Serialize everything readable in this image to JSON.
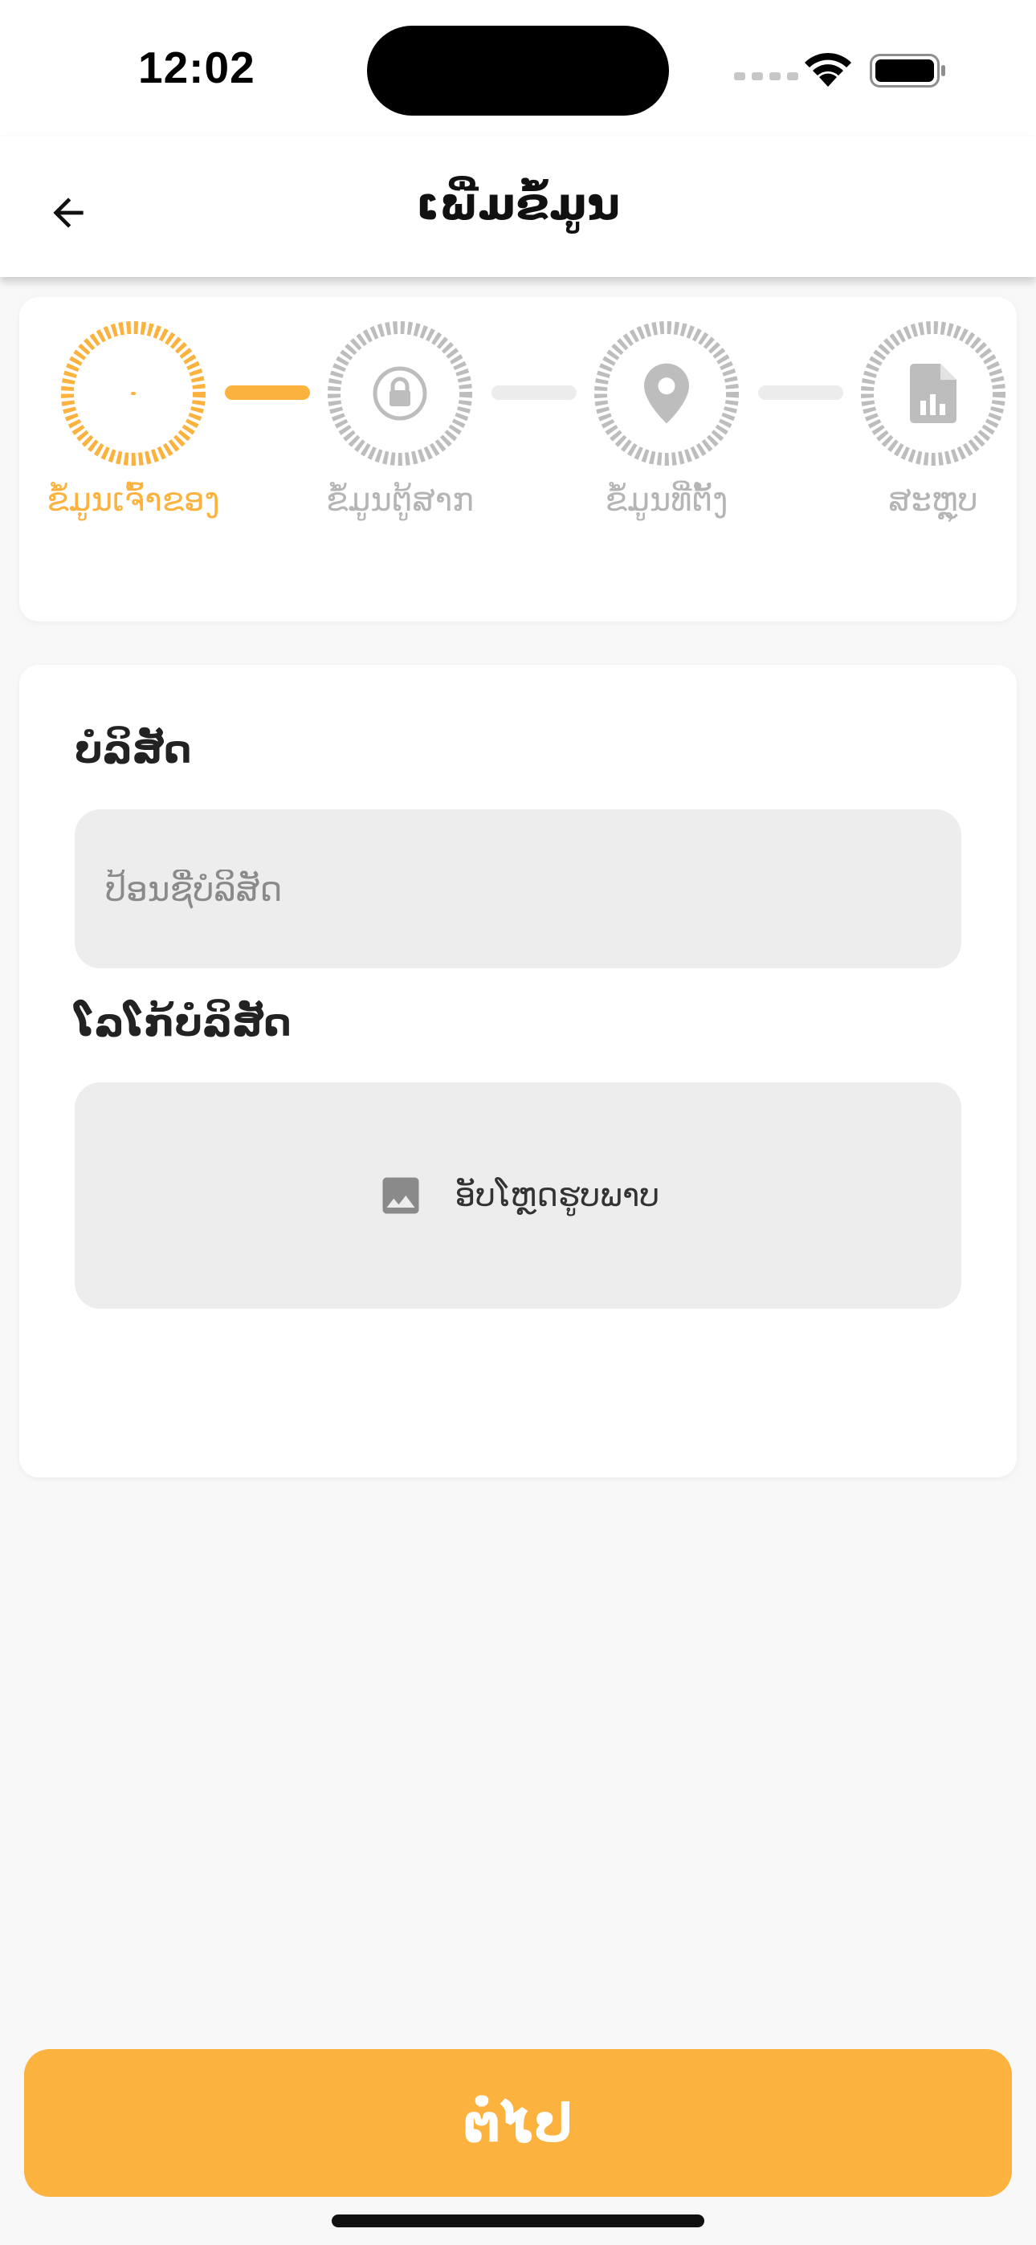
{
  "status_bar": {
    "time": "12:02"
  },
  "header": {
    "title": "ເພີ່ມຂໍ້ມູນ",
    "back_icon": "arrow-left-icon"
  },
  "stepper": {
    "steps": [
      {
        "label": "ຂໍ້ມູນເຈົ້າຂອງ",
        "icon": "loading-dot-icon",
        "state": "active"
      },
      {
        "label": "ຂໍ້ມູນຕູ້ສາກ",
        "icon": "lock-icon",
        "state": "inactive"
      },
      {
        "label": "ຂໍ້ມູນທີ່ຕັ້ງ",
        "icon": "location-pin-icon",
        "state": "inactive"
      },
      {
        "label": "ສະຫຼຸບ",
        "icon": "report-file-icon",
        "state": "inactive"
      }
    ],
    "active_color": "#fcb23e",
    "inactive_color": "#bdbdbd"
  },
  "form": {
    "company_label": "ບໍລິສັດ",
    "company_placeholder": "ປ້ອນຊື່ບໍລິສັດ",
    "company_value": "",
    "logo_label": "ໂລໂກ້ບໍລິສັດ",
    "upload_label": "ອັບໂຫຼດຮູບພາບ",
    "upload_icon": "image-icon"
  },
  "footer": {
    "next_label": "ຕໍ່ໄປ"
  },
  "colors": {
    "accent": "#fcb23e",
    "input_bg": "#ededed",
    "page_bg": "#f8f8f8"
  }
}
